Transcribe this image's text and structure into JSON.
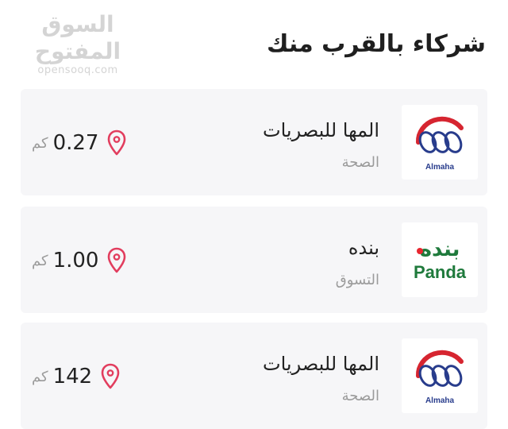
{
  "watermark": {
    "arabic": "السوق المفتوح",
    "latin": "opensooq.com"
  },
  "section": {
    "title": "شركاء بالقرب منك"
  },
  "partners": [
    {
      "name": "المها للبصريات",
      "category": "الصحة",
      "distance": "0.27",
      "unit": "كم",
      "logo": "almaha-optics-logo",
      "logo_text": "Almaha"
    },
    {
      "name": "بنده",
      "category": "التسوق",
      "distance": "1.00",
      "unit": "كم",
      "logo": "panda-logo",
      "logo_text": "Panda",
      "logo_text_ar": "بنده"
    },
    {
      "name": "المها للبصريات",
      "category": "الصحة",
      "distance": "142",
      "unit": "كم",
      "logo": "almaha-optics-logo",
      "logo_text": "Almaha"
    }
  ],
  "colors": {
    "pin": "#e23d5e",
    "almaha_red": "#d62530",
    "almaha_blue": "#283c8c",
    "panda_green": "#1f7a3c",
    "panda_red": "#e8262f"
  },
  "icons": {
    "distance": "location-pin-icon"
  }
}
